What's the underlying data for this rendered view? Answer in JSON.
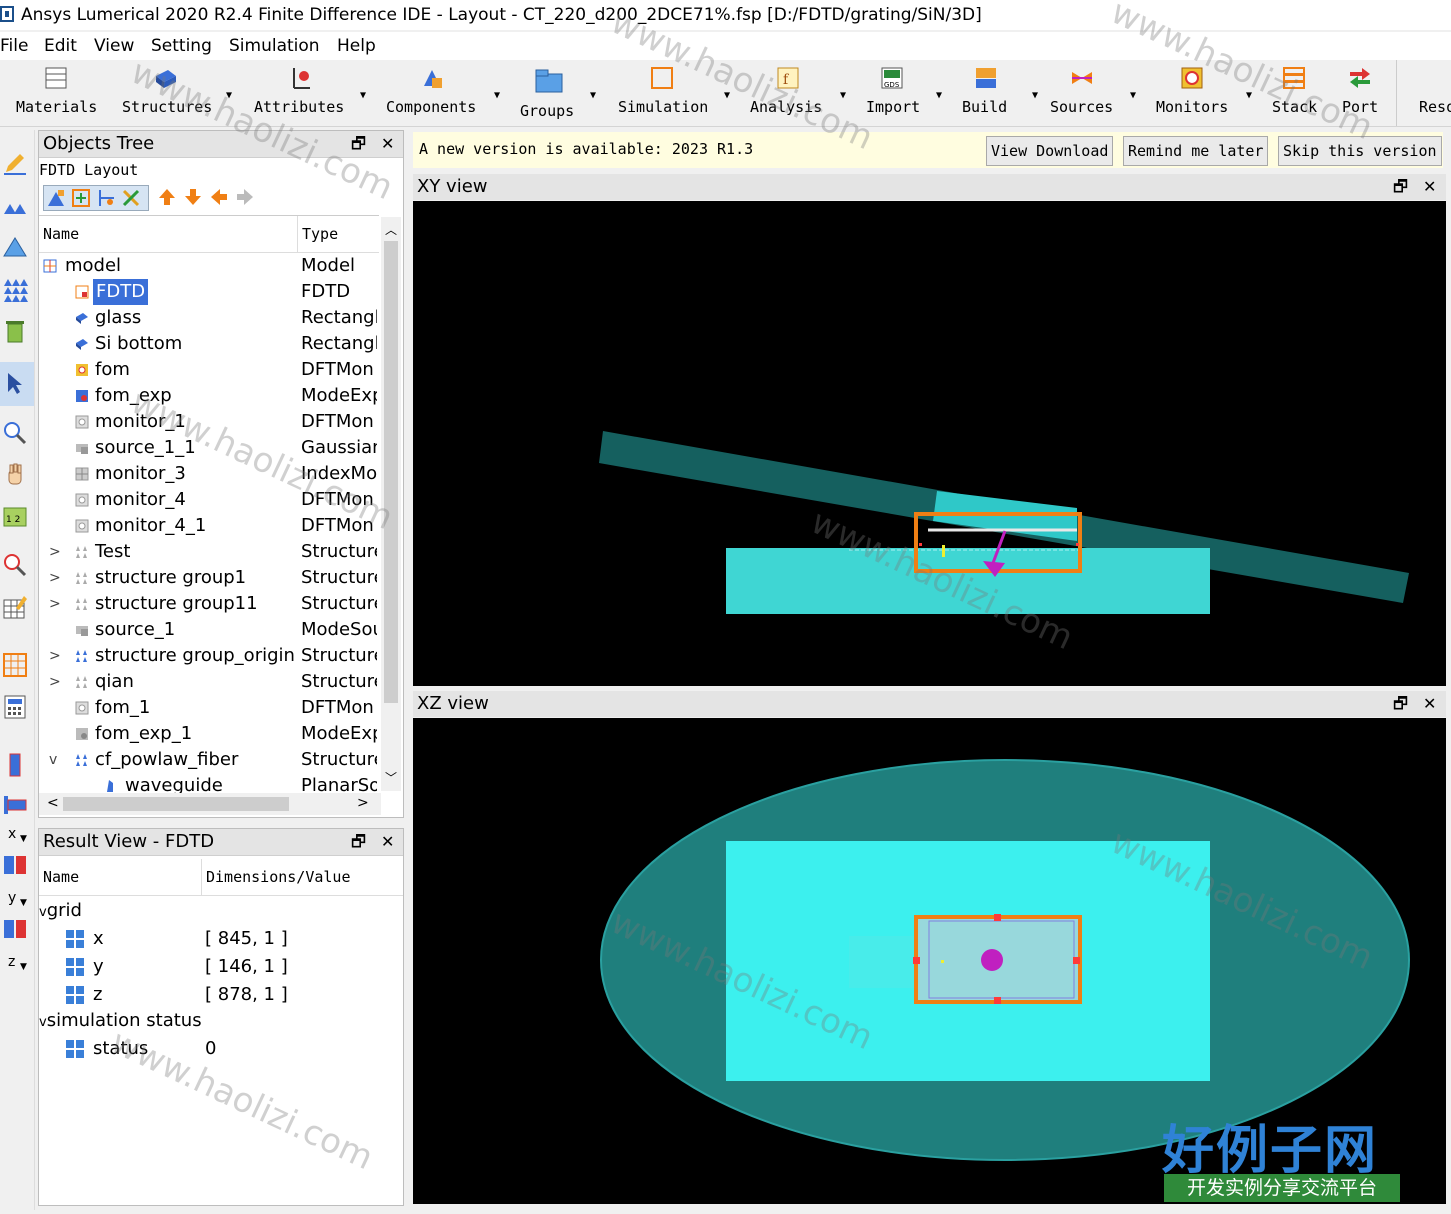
{
  "window": {
    "title": "Ansys Lumerical 2020 R2.4 Finite Difference IDE - Layout - CT_220_d200_2DCE71%.fsp [D:/FDTD/grating/SiN/3D]"
  },
  "menu": [
    "File",
    "Edit",
    "View",
    "Setting",
    "Simulation",
    "Help"
  ],
  "toolbar": [
    {
      "label": "Materials",
      "icon": "materials-icon"
    },
    {
      "label": "Structures",
      "icon": "structures-icon"
    },
    {
      "label": "Attributes",
      "icon": "attributes-icon"
    },
    {
      "label": "Components",
      "icon": "components-icon"
    },
    {
      "label": "Groups",
      "icon": "groups-icon"
    },
    {
      "label": "Simulation",
      "icon": "simulation-icon"
    },
    {
      "label": "Analysis",
      "icon": "analysis-icon"
    },
    {
      "label": "Import",
      "icon": "import-icon"
    },
    {
      "label": "Build",
      "icon": "build-icon"
    },
    {
      "label": "Sources",
      "icon": "sources-icon"
    },
    {
      "label": "Monitors",
      "icon": "monitors-icon"
    },
    {
      "label": "Stack",
      "icon": "stack-icon"
    },
    {
      "label": "Port",
      "icon": "port-icon"
    },
    {
      "label": "Reso",
      "icon": "resources-icon"
    }
  ],
  "objects_tree": {
    "title": "Objects Tree",
    "layout_label": "FDTD Layout",
    "col_name": "Name",
    "col_type": "Type",
    "rows": [
      {
        "name": "model",
        "type": "Model"
      },
      {
        "name": "FDTD",
        "type": "FDTD"
      },
      {
        "name": "glass",
        "type": "Rectangl"
      },
      {
        "name": "Si bottom",
        "type": "Rectangl"
      },
      {
        "name": "fom",
        "type": "DFTMon"
      },
      {
        "name": "fom_exp",
        "type": "ModeExp"
      },
      {
        "name": "monitor_1",
        "type": "DFTMon"
      },
      {
        "name": "source_1_1",
        "type": "Gaussian"
      },
      {
        "name": "monitor_3",
        "type": "IndexMo"
      },
      {
        "name": "monitor_4",
        "type": "DFTMon"
      },
      {
        "name": "monitor_4_1",
        "type": "DFTMon"
      },
      {
        "name": "Test",
        "type": "Structure"
      },
      {
        "name": "structure group1",
        "type": "Structure"
      },
      {
        "name": "structure group11",
        "type": "Structure"
      },
      {
        "name": "source_1",
        "type": "ModeSou"
      },
      {
        "name": "structure group_origin",
        "type": "Structure"
      },
      {
        "name": "qian",
        "type": "Structure"
      },
      {
        "name": "fom_1",
        "type": "DFTMon"
      },
      {
        "name": "fom_exp_1",
        "type": "ModeExp"
      },
      {
        "name": "cf_powlaw_fiber",
        "type": "Structure"
      },
      {
        "name": "waveguide",
        "type": "PlanarSo"
      }
    ]
  },
  "result_view": {
    "title": "Result View - FDTD",
    "col_name": "Name",
    "col_value": "Dimensions/Value",
    "groups": [
      {
        "name": "grid",
        "items": [
          {
            "name": "x",
            "value": "[ 845, 1 ]"
          },
          {
            "name": "y",
            "value": "[ 146, 1 ]"
          },
          {
            "name": "z",
            "value": "[ 878, 1 ]"
          }
        ]
      },
      {
        "name": "simulation status",
        "items": [
          {
            "name": "status",
            "value": "0"
          }
        ]
      }
    ]
  },
  "notification": {
    "message": "A new version is available: 2023 R1.3",
    "view_download": "View Download",
    "remind_later": "Remind me later",
    "skip_version": "Skip this version"
  },
  "views": {
    "xy": "XY view",
    "xz": "XZ view"
  },
  "left_axes": {
    "x": "x",
    "y": "y",
    "z": "z"
  },
  "watermark": {
    "text": "www.haolizi.com",
    "logo_big": "好例子网",
    "logo_small": "开发实例分享交流平台"
  },
  "colors": {
    "canvas_bg": "#000000",
    "substrate": "#3ad0d0",
    "fiber": "#1a6f6f",
    "fdtd_region": "#f07f14",
    "source_arrow": "#c020c0",
    "notify_bg": "#fffde0",
    "selection": "#3a6fd8"
  }
}
